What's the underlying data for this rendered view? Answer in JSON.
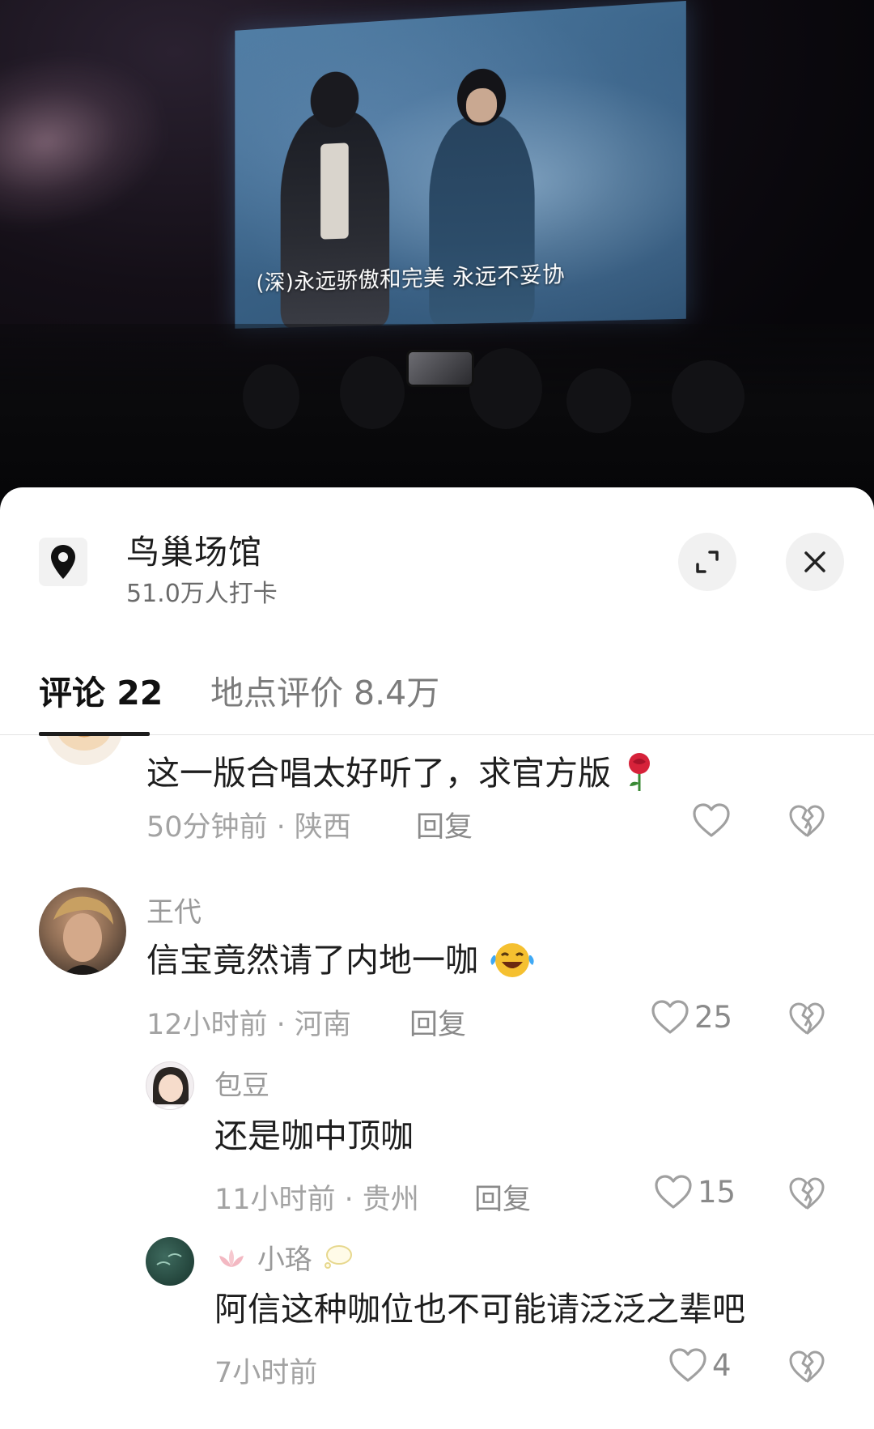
{
  "video": {
    "subtitle": "(深)永远骄傲和完美 永远不妥协"
  },
  "location": {
    "name": "鸟巢场馆",
    "checkins": "51.0万人打卡"
  },
  "tabs": [
    {
      "label": "评论 22",
      "active": true
    },
    {
      "label": "地点评价 8.4万",
      "active": false
    }
  ],
  "comments": [
    {
      "text": "这一版合唱太好听了，求官方版",
      "emoji": "rose-emoji",
      "time_location": "50分钟前 · 陕西",
      "reply_label": "回复",
      "likes": ""
    },
    {
      "username": "王代",
      "text": "信宝竟然请了内地一咖",
      "emoji": "laughing-crying-emoji",
      "time_location": "12小时前 · 河南",
      "reply_label": "回复",
      "likes": "25"
    },
    {
      "username": "包豆",
      "text": "还是咖中顶咖",
      "time_location": "11小时前 · 贵州",
      "reply_label": "回复",
      "likes": "15"
    },
    {
      "username": "小珞",
      "text": "阿信这种咖位也不可能请泛泛之辈吧",
      "time_location": "7小时前",
      "likes": "4"
    }
  ],
  "colors": {
    "sheet_bg": "#ffffff",
    "text_primary": "#1e1e1e",
    "text_secondary": "#a3a3a3",
    "accent_underline": "#1d1d1d"
  }
}
